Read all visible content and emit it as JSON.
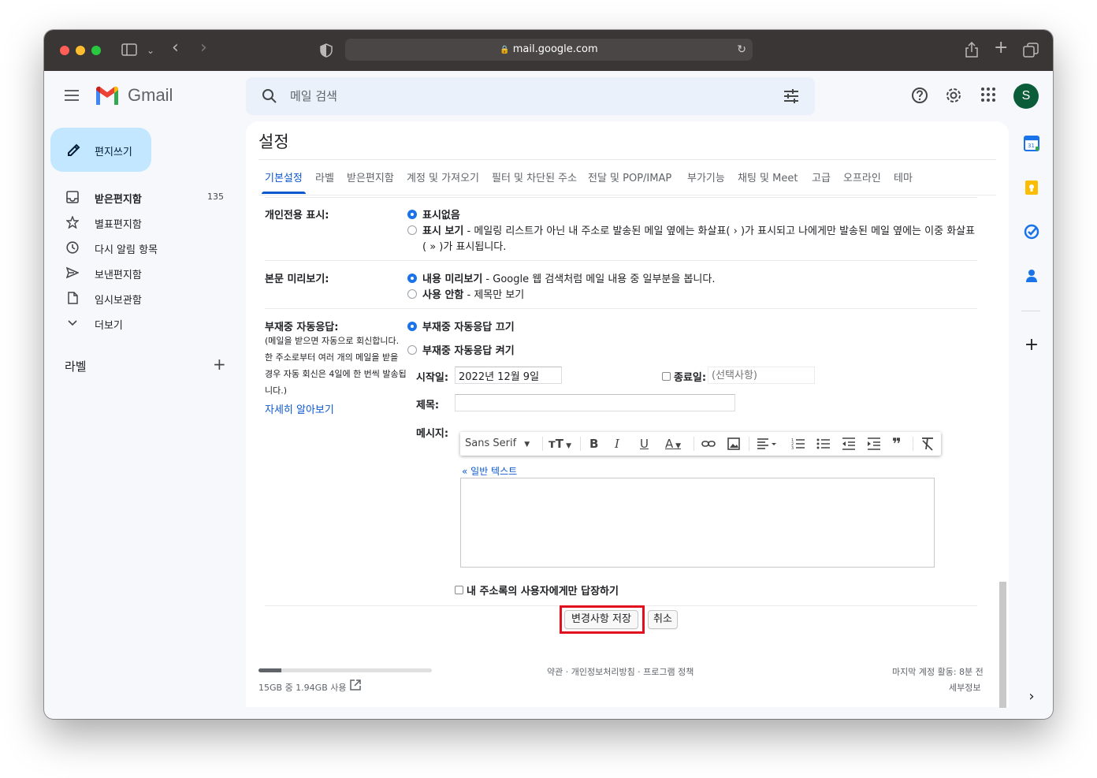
{
  "browser": {
    "url": "mail.google.com"
  },
  "header": {
    "app_name": "Gmail",
    "search_placeholder": "메일 검색",
    "avatar_initial": "S"
  },
  "compose_label": "편지쓰기",
  "nav": {
    "items": [
      {
        "label": "받은편지함",
        "count": "135",
        "icon": "inbox-icon",
        "bold": true
      },
      {
        "label": "별표편지함",
        "icon": "star-icon"
      },
      {
        "label": "다시 알림 항목",
        "icon": "clock-icon"
      },
      {
        "label": "보낸편지함",
        "icon": "send-icon"
      },
      {
        "label": "임시보관함",
        "icon": "draft-icon"
      },
      {
        "label": "더보기",
        "icon": "chevron-down-icon"
      }
    ],
    "labels_title": "라벨"
  },
  "settings": {
    "title": "설정",
    "tabs": [
      "기본설정",
      "라벨",
      "받은편지함",
      "계정 및 가져오기",
      "필터 및 차단된 주소",
      "전달 및 POP/IMAP",
      "부가기능",
      "채팅 및 Meet",
      "고급",
      "오프라인",
      "테마"
    ],
    "active_tab": "기본설정",
    "personal_indicators": {
      "label": "개인전용 표시:",
      "opt1": "표시없음",
      "opt2_bold": "표시 보기",
      "opt2_line1": " - 메일링 리스트가 아닌 내 주소로 발송된 메일 옆에는 화살표( › )가 표시되고 나에게만 발송된 메일 옆에는 이중 화살표",
      "opt2_line2": "( » )가 표시됩니다.",
      "selected": "표시없음"
    },
    "snippets": {
      "label": "본문 미리보기:",
      "opt1_bold": "내용 미리보기",
      "opt1_rest": " - Google 웹 검색처럼 메일 내용 중 일부분을 봅니다.",
      "opt2_bold": "사용 안함",
      "opt2_rest": " - 제목만 보기",
      "selected": "내용 미리보기"
    },
    "vacation": {
      "label": "부재중 자동응답:",
      "desc1": "(메일을 받으면 자동으로 회신합니다.",
      "desc2": "한 주소로부터 여러 개의 메일을 받을",
      "desc3": "경우 자동 회신은 4일에 한 번씩 발송됩",
      "desc4": "니다.)",
      "learn_more": "자세히 알아보기",
      "off": "부재중 자동응답 끄기",
      "on": "부재중 자동응답 켜기",
      "selected": "부재중 자동응답 끄기",
      "start_label": "시작일:",
      "start_value": "2022년 12월 9일",
      "end_label": "종료일:",
      "end_placeholder": "(선택사항)",
      "subject_label": "제목:",
      "subject_value": "",
      "message_label": "메시지:",
      "font_name": "Sans Serif",
      "plain_text_link": "« 일반 텍스트",
      "contacts_only": "내 주소록의 사용자에게만 답장하기"
    },
    "save_button": "변경사항 저장",
    "cancel_button": "취소"
  },
  "footer": {
    "storage": "15GB 중 1.94GB 사용",
    "storage_fraction": 0.13,
    "policies": "약관 · 개인정보처리방침 · 프로그램 정책",
    "last_activity": "마지막 계정 활동: 8분 전",
    "details": "세부정보"
  },
  "colors": {
    "accent": "#0b57d0",
    "compose_bg": "#c2e7ff",
    "highlight": "#e0101e",
    "avatar": "#0b5d3a"
  }
}
